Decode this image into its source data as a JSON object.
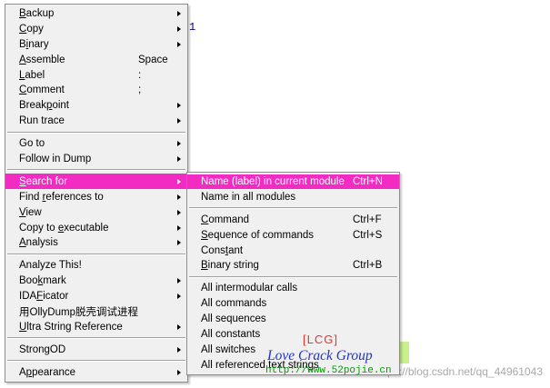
{
  "background": {
    "stray_digit": "1",
    "watermark": "https://blog.csdn.net/qq_44961043",
    "lcg_tag": "[LCG]",
    "group_name": "Love Crack Group",
    "site_url": "http://www.52pojie.cn"
  },
  "colors": {
    "menu_bg": "#F0F0F0",
    "highlight": "#F22BC2",
    "highlight_text": "#FFFFFF",
    "text": "#000000"
  },
  "context_menu": {
    "items": [
      {
        "type": "item",
        "pre": "",
        "key": "B",
        "post": "ackup",
        "shortcut": "",
        "submenu": true,
        "highlighted": false
      },
      {
        "type": "item",
        "pre": "",
        "key": "C",
        "post": "opy",
        "shortcut": "",
        "submenu": true,
        "highlighted": false
      },
      {
        "type": "item",
        "pre": "B",
        "key": "i",
        "post": "nary",
        "shortcut": "",
        "submenu": true,
        "highlighted": false
      },
      {
        "type": "item",
        "pre": "",
        "key": "A",
        "post": "ssemble",
        "shortcut": "Space",
        "submenu": false,
        "highlighted": false
      },
      {
        "type": "item",
        "pre": "",
        "key": "L",
        "post": "abel",
        "shortcut": ":",
        "submenu": false,
        "highlighted": false
      },
      {
        "type": "item",
        "pre": "",
        "key": "C",
        "post": "omment",
        "shortcut": ";",
        "submenu": false,
        "highlighted": false
      },
      {
        "type": "item",
        "pre": "Break",
        "key": "p",
        "post": "oint",
        "shortcut": "",
        "submenu": true,
        "highlighted": false
      },
      {
        "type": "item",
        "pre": "Run trace",
        "key": "",
        "post": "",
        "shortcut": "",
        "submenu": true,
        "highlighted": false
      },
      {
        "type": "separator"
      },
      {
        "type": "item",
        "pre": "Go to",
        "key": "",
        "post": "",
        "shortcut": "",
        "submenu": true,
        "highlighted": false
      },
      {
        "type": "item",
        "pre": "Follow in Dump",
        "key": "",
        "post": "",
        "shortcut": "",
        "submenu": true,
        "highlighted": false
      },
      {
        "type": "separator"
      },
      {
        "type": "item",
        "pre": "",
        "key": "S",
        "post": "earch for",
        "shortcut": "",
        "submenu": true,
        "highlighted": true
      },
      {
        "type": "item",
        "pre": "Find ",
        "key": "r",
        "post": "eferences to",
        "shortcut": "",
        "submenu": true,
        "highlighted": false
      },
      {
        "type": "item",
        "pre": "",
        "key": "V",
        "post": "iew",
        "shortcut": "",
        "submenu": true,
        "highlighted": false
      },
      {
        "type": "item",
        "pre": "Copy to ",
        "key": "e",
        "post": "xecutable",
        "shortcut": "",
        "submenu": true,
        "highlighted": false
      },
      {
        "type": "item",
        "pre": "",
        "key": "A",
        "post": "nalysis",
        "shortcut": "",
        "submenu": true,
        "highlighted": false
      },
      {
        "type": "separator"
      },
      {
        "type": "item",
        "pre": "Analyze This!",
        "key": "",
        "post": "",
        "shortcut": "",
        "submenu": false,
        "highlighted": false
      },
      {
        "type": "item",
        "pre": "Boo",
        "key": "k",
        "post": "mark",
        "shortcut": "",
        "submenu": true,
        "highlighted": false
      },
      {
        "type": "item",
        "pre": "IDA",
        "key": "F",
        "post": "icator",
        "shortcut": "",
        "submenu": true,
        "highlighted": false
      },
      {
        "type": "item",
        "pre": "用OllyDump脱壳调试进程",
        "key": "",
        "post": "",
        "shortcut": "",
        "submenu": false,
        "highlighted": false
      },
      {
        "type": "item",
        "pre": "",
        "key": "U",
        "post": "ltra String Reference",
        "shortcut": "",
        "submenu": true,
        "highlighted": false
      },
      {
        "type": "separator"
      },
      {
        "type": "item",
        "pre": "StrongOD",
        "key": "",
        "post": "",
        "shortcut": "",
        "submenu": true,
        "highlighted": false
      },
      {
        "type": "separator"
      },
      {
        "type": "item",
        "pre": "A",
        "key": "p",
        "post": "pearance",
        "shortcut": "",
        "submenu": true,
        "highlighted": false
      }
    ]
  },
  "search_submenu": {
    "items": [
      {
        "type": "item",
        "pre": "Name (label) in current module",
        "key": "",
        "post": "",
        "shortcut": "Ctrl+N",
        "submenu": false,
        "highlighted": true
      },
      {
        "type": "item",
        "pre": "Name in all modules",
        "key": "",
        "post": "",
        "shortcut": "",
        "submenu": false,
        "highlighted": false
      },
      {
        "type": "separator"
      },
      {
        "type": "item",
        "pre": "",
        "key": "C",
        "post": "ommand",
        "shortcut": "Ctrl+F",
        "submenu": false,
        "highlighted": false
      },
      {
        "type": "item",
        "pre": "",
        "key": "S",
        "post": "equence of commands",
        "shortcut": "Ctrl+S",
        "submenu": false,
        "highlighted": false
      },
      {
        "type": "item",
        "pre": "Cons",
        "key": "t",
        "post": "ant",
        "shortcut": "",
        "submenu": false,
        "highlighted": false
      },
      {
        "type": "item",
        "pre": "",
        "key": "B",
        "post": "inary string",
        "shortcut": "Ctrl+B",
        "submenu": false,
        "highlighted": false
      },
      {
        "type": "separator"
      },
      {
        "type": "item",
        "pre": "All intermodular calls",
        "key": "",
        "post": "",
        "shortcut": "",
        "submenu": false,
        "highlighted": false
      },
      {
        "type": "item",
        "pre": "All commands",
        "key": "",
        "post": "",
        "shortcut": "",
        "submenu": false,
        "highlighted": false
      },
      {
        "type": "item",
        "pre": "All sequences",
        "key": "",
        "post": "",
        "shortcut": "",
        "submenu": false,
        "highlighted": false
      },
      {
        "type": "item",
        "pre": "All constants",
        "key": "",
        "post": "",
        "shortcut": "",
        "submenu": false,
        "highlighted": false
      },
      {
        "type": "item",
        "pre": "All switches",
        "key": "",
        "post": "",
        "shortcut": "",
        "submenu": false,
        "highlighted": false
      },
      {
        "type": "item",
        "pre": "All referenced text strings",
        "key": "",
        "post": "",
        "shortcut": "",
        "submenu": false,
        "highlighted": false
      }
    ]
  }
}
